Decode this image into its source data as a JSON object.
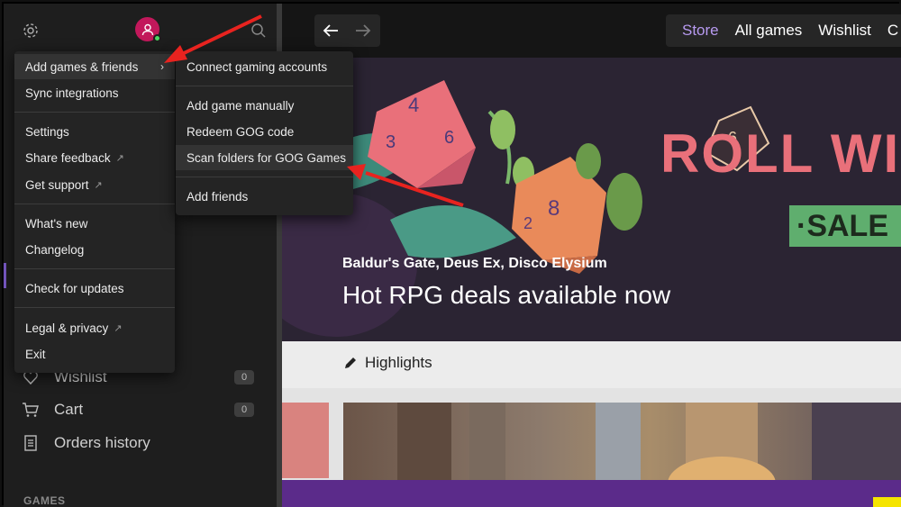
{
  "sidebar": {
    "items": [
      {
        "label": "Wishlist",
        "icon": "heart-icon",
        "count": "0"
      },
      {
        "label": "Cart",
        "icon": "cart-icon",
        "count": "0"
      },
      {
        "label": "Orders history",
        "icon": "receipt-icon"
      }
    ],
    "games_heading": "GAMES",
    "avatar_status_color": "#4cd964"
  },
  "main_menu": {
    "add_games": "Add games & friends",
    "sync": "Sync integrations",
    "settings": "Settings",
    "share_feedback": "Share feedback",
    "get_support": "Get support",
    "whats_new": "What's new",
    "changelog": "Changelog",
    "check_updates": "Check for updates",
    "legal": "Legal & privacy",
    "exit": "Exit",
    "external_mark": "↗"
  },
  "sub_menu": {
    "connect": "Connect gaming accounts",
    "add_manual": "Add game manually",
    "redeem": "Redeem GOG code",
    "scan": "Scan folders for GOG Games",
    "add_friends": "Add friends"
  },
  "topbar": {
    "tabs": [
      "Store",
      "All games",
      "Wishlist",
      "C"
    ],
    "active_tab": "Store",
    "accent": "#b79af0"
  },
  "hero": {
    "subtitle": "Baldur's Gate, Deus Ex, Disco Elysium",
    "title": "Hot RPG deals available now",
    "banner_text": "ROLL WI",
    "sale_text": "·SALE"
  },
  "highlights": {
    "title": "Highlights"
  },
  "annotation_color": "#e8231f"
}
